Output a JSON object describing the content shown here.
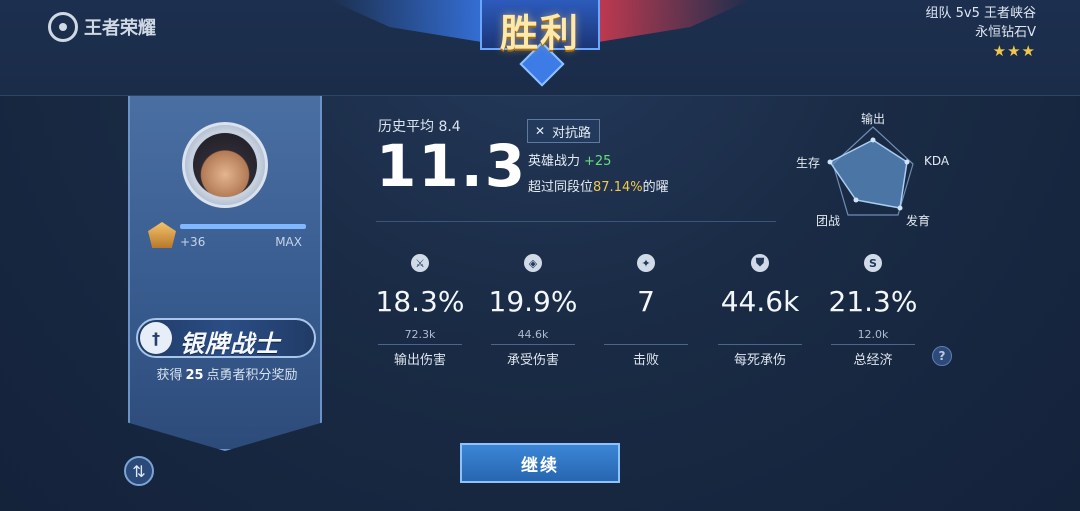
{
  "header": {
    "logo_text": "王者荣耀",
    "banner_title": "胜利",
    "match_mode": "组队 5v5 王者峡谷",
    "rank_name": "永恒钻石V",
    "stars": "★★★"
  },
  "player": {
    "xp_gain": "+36",
    "xp_max": "MAX",
    "xp_progress": 1.0,
    "badge_title": "银牌战士",
    "reward_prefix": "获得",
    "reward_amount": "25",
    "reward_suffix": "点勇者积分奖励"
  },
  "performance": {
    "history_avg": "历史平均 8.4",
    "score": "11.3",
    "lane": "对抗路",
    "hero_power_label": "英雄战力",
    "hero_power_delta": "+25",
    "exceed_prefix": "超过同段位",
    "exceed_pct": "87.14%",
    "exceed_suffix": "的曜"
  },
  "radar": {
    "labels": {
      "top": "输出",
      "right": "KDA",
      "bottom_right": "发育",
      "bottom_left": "团战",
      "left": "生存"
    },
    "colors": {
      "fill": "#5b8fc4",
      "stroke": "#a9cdf2",
      "grid": "#6f8db6"
    }
  },
  "stats": [
    {
      "icon": "damage-dealt-icon",
      "glyph": "⚔",
      "value": "18.3%",
      "sub": "72.3k",
      "label": "输出伤害"
    },
    {
      "icon": "damage-taken-icon",
      "glyph": "◈",
      "value": "19.9%",
      "sub": "44.6k",
      "label": "承受伤害"
    },
    {
      "icon": "kills-icon",
      "glyph": "✦",
      "value": "7",
      "sub": "",
      "label": "击败"
    },
    {
      "icon": "shield-icon",
      "glyph": "⛊",
      "value": "44.6k",
      "sub": "",
      "label": "每死承伤"
    },
    {
      "icon": "gold-icon",
      "glyph": "S",
      "value": "21.3%",
      "sub": "12.0k",
      "label": "总经济"
    }
  ],
  "buttons": {
    "continue": "继续",
    "help": "?"
  }
}
